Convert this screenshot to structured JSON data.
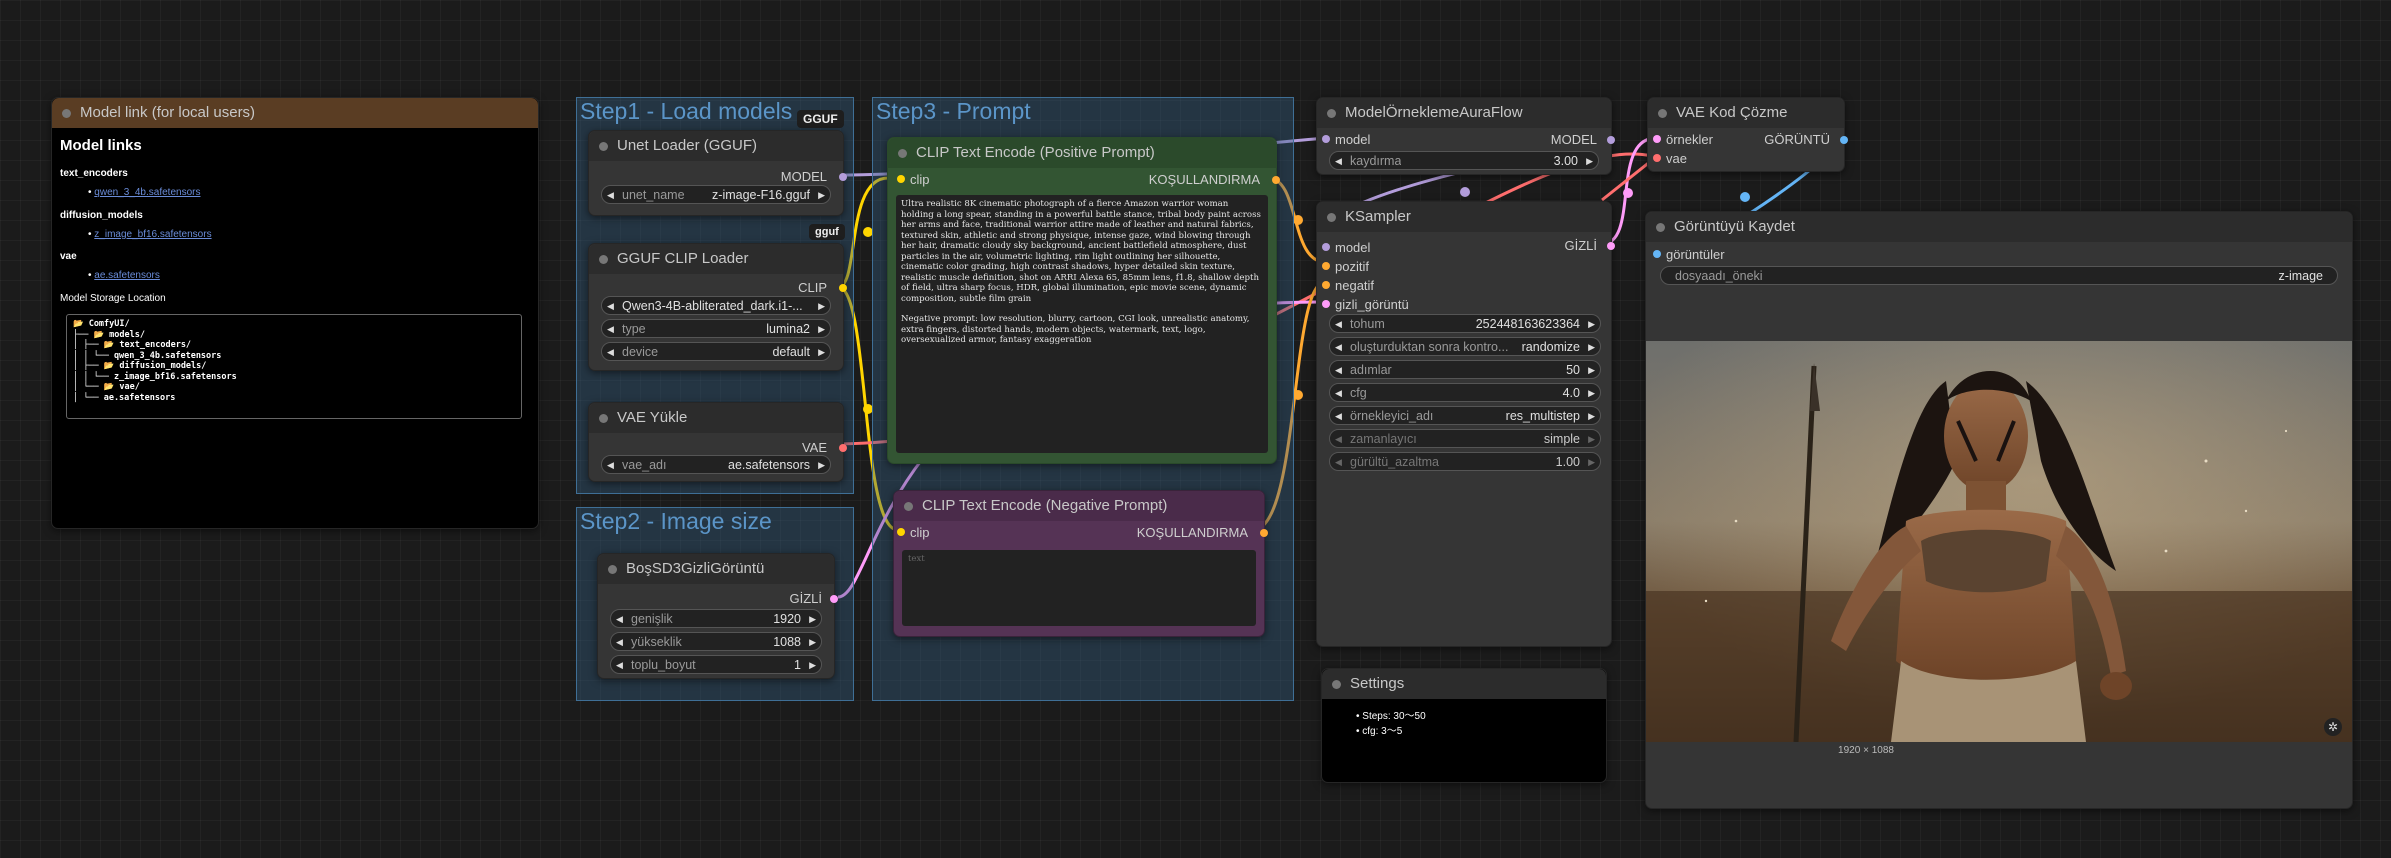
{
  "model_link": {
    "title": "Model link (for local users)",
    "heading": "Model links",
    "sections": [
      {
        "name": "text_encoders",
        "link": "qwen_3_4b.safetensors"
      },
      {
        "name": "diffusion_models",
        "link": "z_image_bf16.safetensors"
      },
      {
        "name": "vae",
        "link": "ae.safetensors"
      }
    ],
    "storage_label": "Model Storage Location",
    "tree": [
      "📂 ComfyUI/",
      "├── 📂 models/",
      "│   ├── 📂 text_encoders/",
      "│   │   └── qwen_3_4b.safetensors",
      "│   ├── 📂 diffusion_models/",
      "│   │   └── z_image_bf16.safetensors",
      "│   └── 📂 vae/",
      "│       └── ae.safetensors"
    ]
  },
  "groups": {
    "step1": "Step1 - Load models",
    "step2": "Step2 - Image size",
    "step3": "Step3 - Prompt"
  },
  "badges": {
    "gguf_upper": "GGUF",
    "gguf_lower": "gguf"
  },
  "unet_loader": {
    "title": "Unet Loader (GGUF)",
    "out": "MODEL",
    "w_label": "unet_name",
    "w_value": "z-image-F16.gguf"
  },
  "clip_loader": {
    "title": "GGUF CLIP Loader",
    "out": "CLIP",
    "widgets": [
      {
        "label": "",
        "value": "Qwen3-4B-abliterated_dark.i1-..."
      },
      {
        "label": "type",
        "value": "lumina2"
      },
      {
        "label": "device",
        "value": "default"
      }
    ]
  },
  "vae_loader": {
    "title": "VAE Yükle",
    "out": "VAE",
    "w_label": "vae_adı",
    "w_value": "ae.safetensors"
  },
  "latent": {
    "title": "BoşSD3GizliGörüntü",
    "out": "GİZLİ",
    "widgets": [
      {
        "label": "genişlik",
        "value": "1920"
      },
      {
        "label": "yükseklik",
        "value": "1088"
      },
      {
        "label": "toplu_boyut",
        "value": "1"
      }
    ]
  },
  "pos_prompt": {
    "title": "CLIP Text Encode (Positive Prompt)",
    "in": "clip",
    "out": "KOŞULLANDIRMA",
    "text1": "Ultra realistic 8K cinematic photograph of a fierce Amazon warrior woman holding a long spear, standing in a powerful battle stance, tribal body paint across her arms and face, traditional warrior attire made of leather and natural fabrics, textured skin, athletic and strong physique, intense gaze, wind blowing through her hair, dramatic cloudy sky background, ancient battlefield atmosphere, dust particles in the air, volumetric lighting, rim light outlining her silhouette, cinematic color grading, high contrast shadows, hyper detailed skin texture, realistic muscle definition, shot on ARRI Alexa 65, 85mm lens, f1.8, shallow depth of field, ultra sharp focus, HDR, global illumination, epic movie scene, dynamic composition, subtle film grain",
    "text2": "Negative prompt: low resolution, blurry, cartoon, CGI look, unrealistic anatomy, extra fingers, distorted hands, modern objects, watermark, text, logo, oversexualized armor, fantasy exaggeration"
  },
  "neg_prompt": {
    "title": "CLIP Text Encode (Negative Prompt)",
    "in": "clip",
    "out": "KOŞULLANDIRMA",
    "placeholder": "text"
  },
  "sampling": {
    "title": "ModelÖrneklemeAuraFlow",
    "in": "model",
    "out": "MODEL",
    "w_label": "kaydırma",
    "w_value": "3.00"
  },
  "ksampler": {
    "title": "KSampler",
    "inputs": [
      "model",
      "pozitif",
      "negatif",
      "gizli_görüntü"
    ],
    "out": "GİZLİ",
    "widgets": [
      {
        "label": "tohum",
        "value": "252448163623364"
      },
      {
        "label": "oluşturduktan sonra kontro...",
        "value": "randomize"
      },
      {
        "label": "adımlar",
        "value": "50"
      },
      {
        "label": "cfg",
        "value": "4.0"
      },
      {
        "label": "örnekleyici_adı",
        "value": "res_multistep"
      },
      {
        "label": "zamanlayıcı",
        "value": "simple"
      },
      {
        "label": "gürültü_azaltma",
        "value": "1.00"
      }
    ]
  },
  "settings": {
    "title": "Settings",
    "items": [
      "Steps: 30～50",
      "cfg: 3～5"
    ]
  },
  "vae_decode": {
    "title": "VAE Kod Çözme",
    "inputs": [
      "örnekler",
      "vae"
    ],
    "out": "GÖRÜNTÜ"
  },
  "save_image": {
    "title": "Görüntüyü Kaydet",
    "in": "görüntüler",
    "w_label": "dosyaadı_öneki",
    "w_value": "z-image",
    "caption": "1920 × 1088"
  },
  "colors": {
    "model": "#b39ddb",
    "clip": "#ffd500",
    "vae": "#ff6e6e",
    "latent": "#ff9cf9",
    "conditioning": "#ffa931",
    "image": "#64b5f6"
  }
}
